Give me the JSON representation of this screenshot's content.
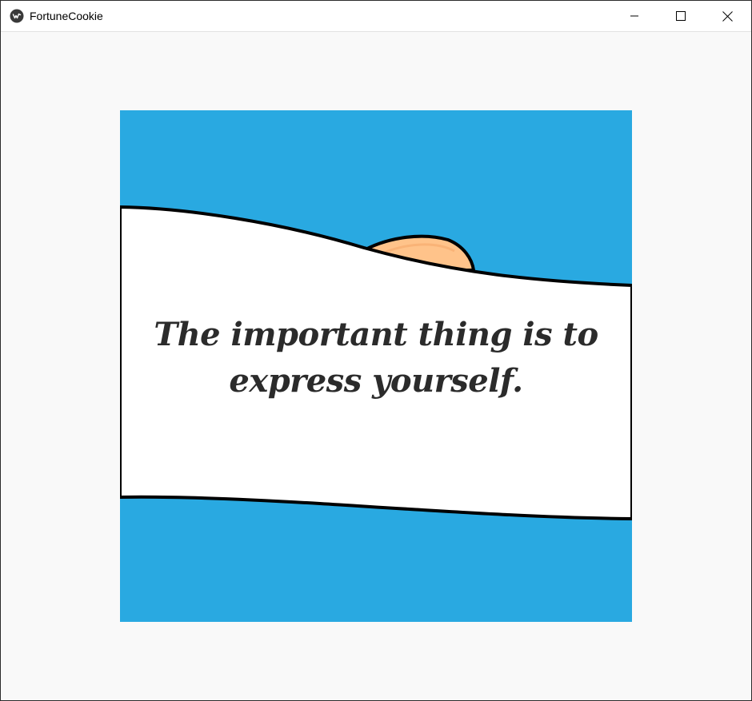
{
  "window": {
    "title": "FortuneCookie",
    "app_icon": "kivy-logo-icon",
    "controls": {
      "minimize_icon": "minimize-icon",
      "maximize_icon": "maximize-icon",
      "close_icon": "close-icon"
    }
  },
  "fortune": {
    "message": "The important thing is to express yourself."
  },
  "colors": {
    "sky": "#29a9e1",
    "paper": "#ffffff",
    "cookie": "#ffc38a",
    "outline": "#000000",
    "text": "#2b2b2b"
  }
}
